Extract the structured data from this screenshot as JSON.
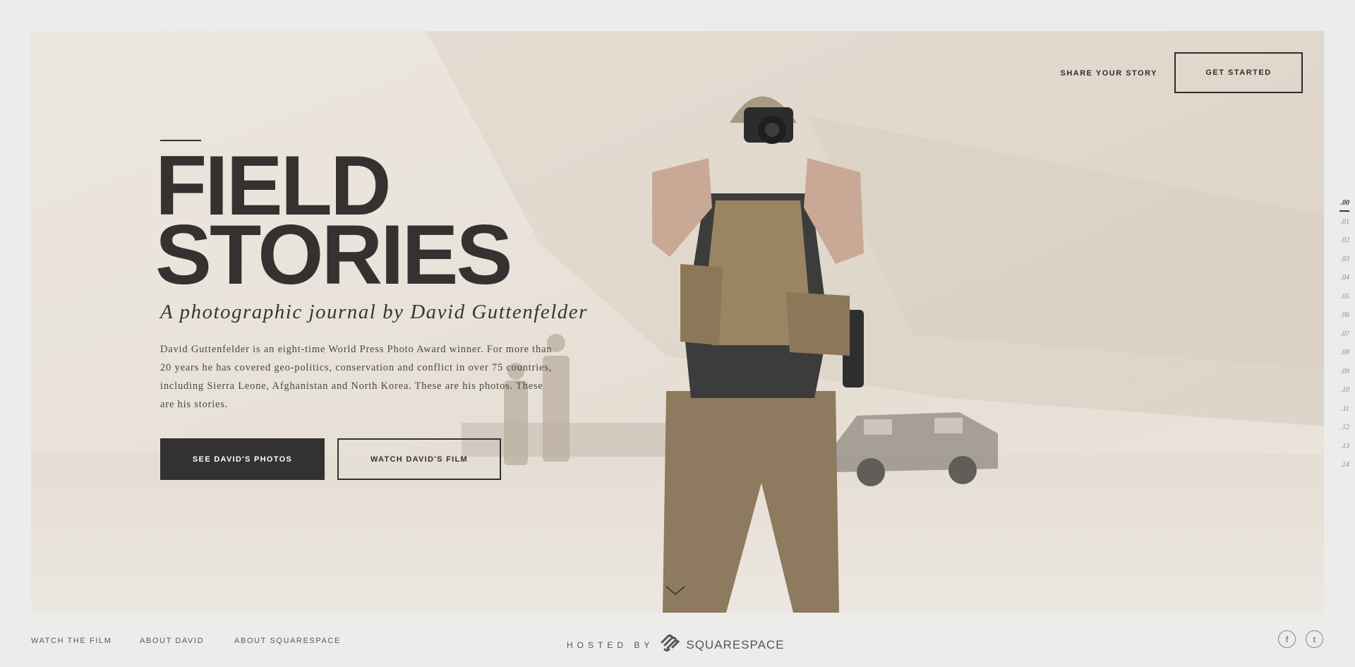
{
  "nav": {
    "share_label": "SHARE YOUR STORY",
    "cta_label": "GET STARTED"
  },
  "hero": {
    "title_line1": "FIELD",
    "title_line2": "STORIES",
    "subtitle": "A photographic journal by David Guttenfelder",
    "bio": "David Guttenfelder is an eight-time World Press Photo Award winner. For more than 20 years he has covered geo-politics, conservation and conflict in over 75 countries, including Sierra Leone, Afghanistan and North Korea. These are his photos. These are his stories.",
    "primary_button": "SEE DAVID'S PHOTOS",
    "secondary_button": "WATCH DAVID'S FILM",
    "scroll_icon": "chevron-down-icon"
  },
  "side_index": {
    "items": [
      ".00",
      ".01",
      ".02",
      ".03",
      ".04",
      ".05",
      ".06",
      ".07",
      ".08",
      ".09",
      ".10",
      ".11",
      ".12",
      ".13",
      ".14"
    ],
    "active": ".00"
  },
  "footer": {
    "links": [
      "WATCH THE FILM",
      "ABOUT DAVID",
      "ABOUT SQUARESPACE"
    ],
    "hosted_by": "HOSTED BY",
    "brand": "SQUARESPACE",
    "social": [
      {
        "icon": "facebook-icon",
        "glyph": "f"
      },
      {
        "icon": "twitter-icon",
        "glyph": "t"
      }
    ]
  },
  "colors": {
    "page_bg": "#ececeb",
    "ink": "#343231",
    "hero_tone": "#e9e3db"
  }
}
